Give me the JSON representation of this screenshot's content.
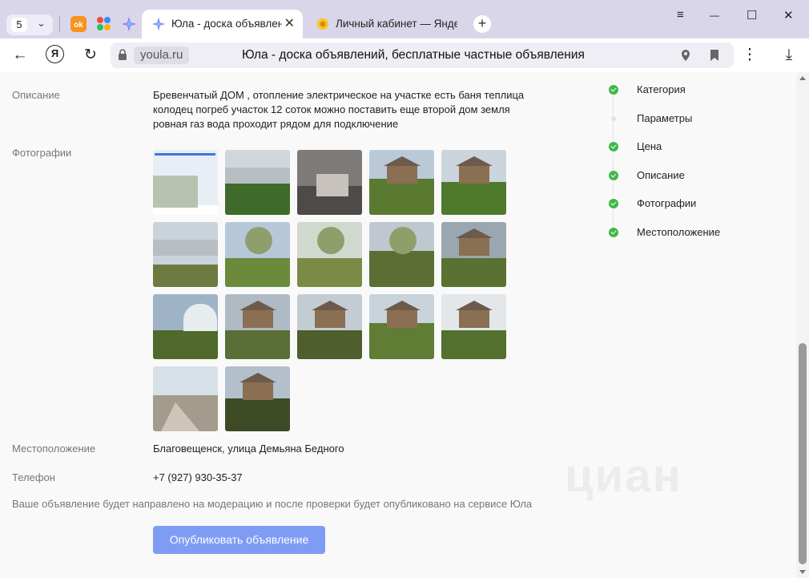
{
  "browser": {
    "tab_count": "5",
    "pinned": {
      "ok_label": "ok"
    },
    "tabs": [
      {
        "title": "Юла - доска объявлений",
        "active": true
      },
      {
        "title": "Личный кабинет — Яндекс",
        "active": false
      }
    ],
    "new_tab_label": "+",
    "window": {
      "menu": "≡",
      "minimize": "—",
      "maximize": "☐",
      "close": "✕"
    },
    "nav": {
      "back": "←",
      "yandex": "Я",
      "reload": "↻"
    },
    "address": {
      "domain": "youla.ru",
      "page_title": "Юла - доска объявлений, бесплатные частные объявления"
    },
    "more": "⋮",
    "download": "⤓"
  },
  "form": {
    "description": {
      "label": "Описание",
      "lines": [
        "Бревенчатый ДОМ , отопление электрическое на участке есть баня теплица",
        "колодец погреб участок 12 соток можно поставить еще второй дом земля",
        "ровная газ вода проходит рядом для подключение"
      ]
    },
    "photos": {
      "label": "Фотографии",
      "count": 17
    },
    "location": {
      "label": "Местоположение",
      "value": "Благовещенск, улица Демьяна Бедного"
    },
    "phone": {
      "label": "Телефон",
      "value": "+7 (927) 930-35-37"
    },
    "notice": "Ваше объявление будет направлено на модерацию и после проверки будет опубликовано на сервисе Юла",
    "publish_button": "Опубликовать объявление"
  },
  "steps": [
    {
      "label": "Категория",
      "done": true
    },
    {
      "label": "Параметры",
      "done": false
    },
    {
      "label": "Цена",
      "done": true
    },
    {
      "label": "Описание",
      "done": true
    },
    {
      "label": "Фотографии",
      "done": true
    },
    {
      "label": "Местоположение",
      "done": true
    }
  ],
  "watermark": "циан",
  "colors": {
    "accent": "#7f9cf5",
    "step_done": "#3db84c",
    "tabstrip": "#dad6ea"
  }
}
